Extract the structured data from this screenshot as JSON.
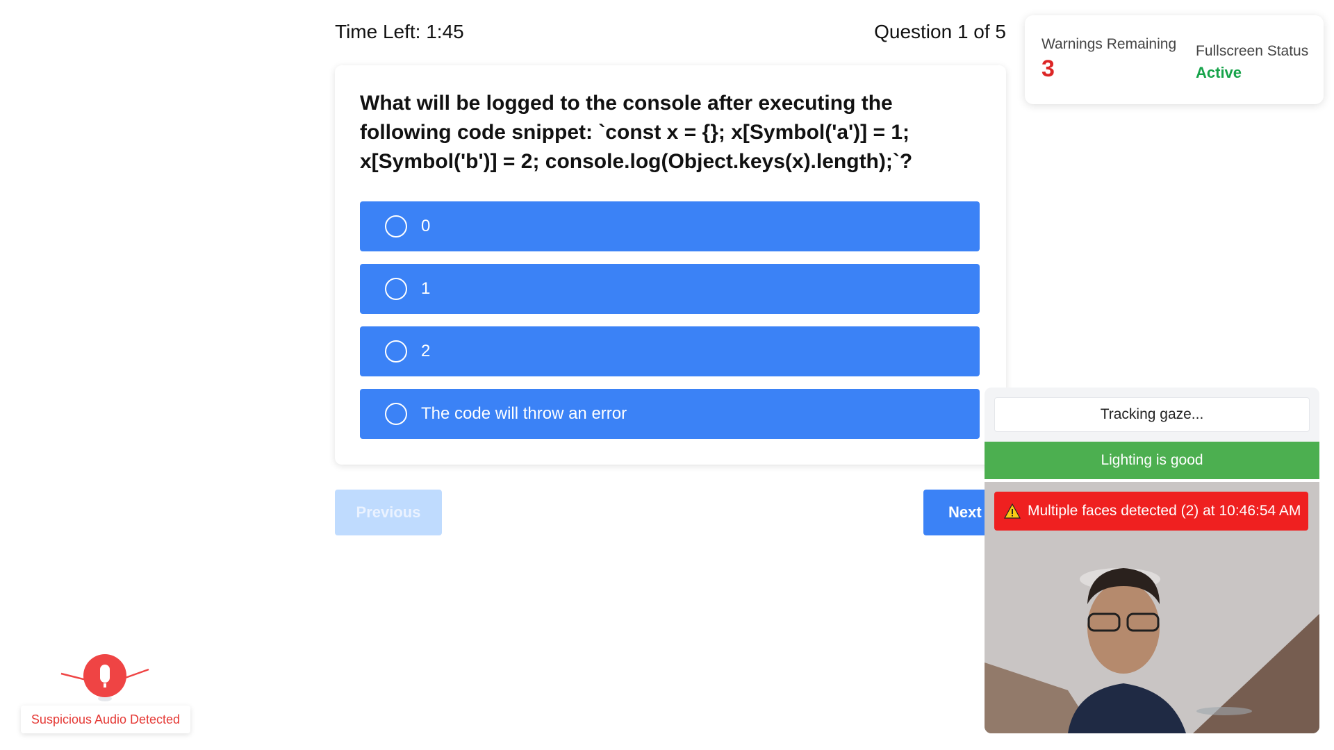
{
  "header": {
    "timer": "Time Left: 1:45",
    "question_counter": "Question 1 of 5"
  },
  "question": {
    "text": "What will be logged to the console after executing the following code snippet: `const x = {}; x[Symbol('a')] = 1; x[Symbol('b')] = 2; console.log(Object.keys(x).length);`?",
    "options": [
      {
        "label": "0"
      },
      {
        "label": "1"
      },
      {
        "label": "2"
      },
      {
        "label": "The code will throw an error"
      }
    ]
  },
  "navigation": {
    "previous_label": "Previous",
    "next_label": "Next"
  },
  "status_panel": {
    "warnings_label": "Warnings Remaining",
    "warnings_value": "3",
    "fullscreen_label": "Fullscreen Status",
    "fullscreen_value": "Active"
  },
  "proctor": {
    "gaze_status": "Tracking gaze...",
    "lighting_status": "Lighting is good",
    "alert_text": "Multiple faces detected (2) at 10:46:54 AM"
  },
  "audio_warning": {
    "text": "Suspicious Audio Detected"
  },
  "colors": {
    "primary": "#3b82f6",
    "primary_disabled": "#bfdbfe",
    "danger": "#dc2626",
    "success": "#16a34a",
    "lighting_ok": "#4caf50",
    "alert_bg": "#ef2020"
  },
  "icons": [
    "radio-circle-icon",
    "warning-triangle-icon",
    "microphone-icon"
  ]
}
